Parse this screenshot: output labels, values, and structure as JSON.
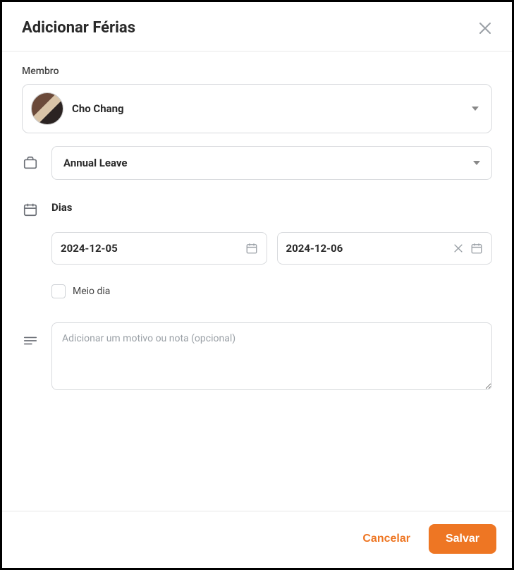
{
  "modal": {
    "title": "Adicionar Férias"
  },
  "labels": {
    "member": "Membro",
    "days": "Dias",
    "halfDay": "Meio dia"
  },
  "member": {
    "name": "Cho Chang"
  },
  "leaveType": {
    "selected": "Annual Leave"
  },
  "dates": {
    "start": "2024-12-05",
    "end": "2024-12-06"
  },
  "notes": {
    "placeholder": "Adicionar um motivo ou nota (opcional)"
  },
  "actions": {
    "cancel": "Cancelar",
    "save": "Salvar"
  },
  "colors": {
    "accent": "#ee7623"
  }
}
